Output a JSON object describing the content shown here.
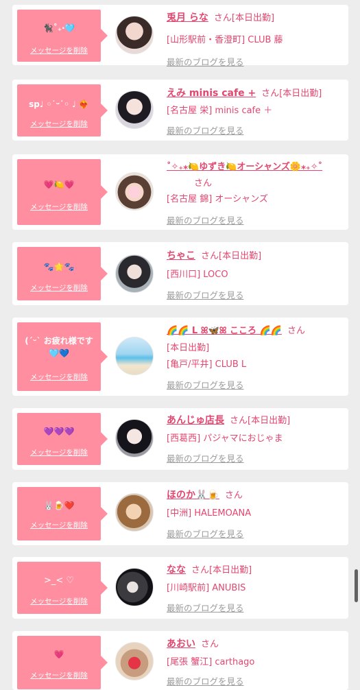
{
  "common": {
    "delete_label": "メッセージを削除",
    "blog_label": "最新のブログを見る",
    "honorific": "さん",
    "on_duty": "[本日出勤]"
  },
  "colors": {
    "bubble": "#ff8fa0",
    "accent": "#e2476f",
    "muted": "#9b9b9b"
  },
  "messages": [
    {
      "message": "🐈‍⬛˚₊‧🩵",
      "name": "兎月 らな",
      "on_duty": true,
      "location": "[山形駅前・香澄町] CLUB 藤"
    },
    {
      "message": "sp♩ ◦˙ᵕ˙◦ ♩ ❤‍🔥",
      "name": "えみ minis cafe +",
      "on_duty": true,
      "location": "[名古屋 栄] minis cafe ＋"
    },
    {
      "message": "💗🍋💗",
      "name": "˚✧₊⁎🍋ゆずき🍋オーシャンズ🌼⁎₊✧˚",
      "on_duty": false,
      "location": "[名古屋 錦] オーシャンズ"
    },
    {
      "message": "🐾🌟🐾",
      "name": "ちゃこ",
      "on_duty": true,
      "location": "[西川口] LOCO"
    },
    {
      "message": "(ˊᵕˋ お疲れ様です",
      "message2": "🩵💙",
      "name": "🌈🌈 L ꕤ🦋ꕤ こころ 🌈🌈",
      "on_duty": true,
      "location": "[亀戸/平井] CLUB L"
    },
    {
      "message": "💜💜💜",
      "name": "あんじゅ店長",
      "on_duty": true,
      "location": "[西葛西] パジャマにおじゃま"
    },
    {
      "message": "🐰🍺❤️",
      "name": "ほのか🐰🍺",
      "on_duty": false,
      "location": "[中洲] HALEMOANA"
    },
    {
      "message": ">_< ♡",
      "name": "なな",
      "on_duty": true,
      "location": "[川崎駅前] ANUBIS"
    },
    {
      "message": "💗",
      "name": "あおい",
      "on_duty": false,
      "location": "[尾張 蟹江] carthago"
    }
  ]
}
